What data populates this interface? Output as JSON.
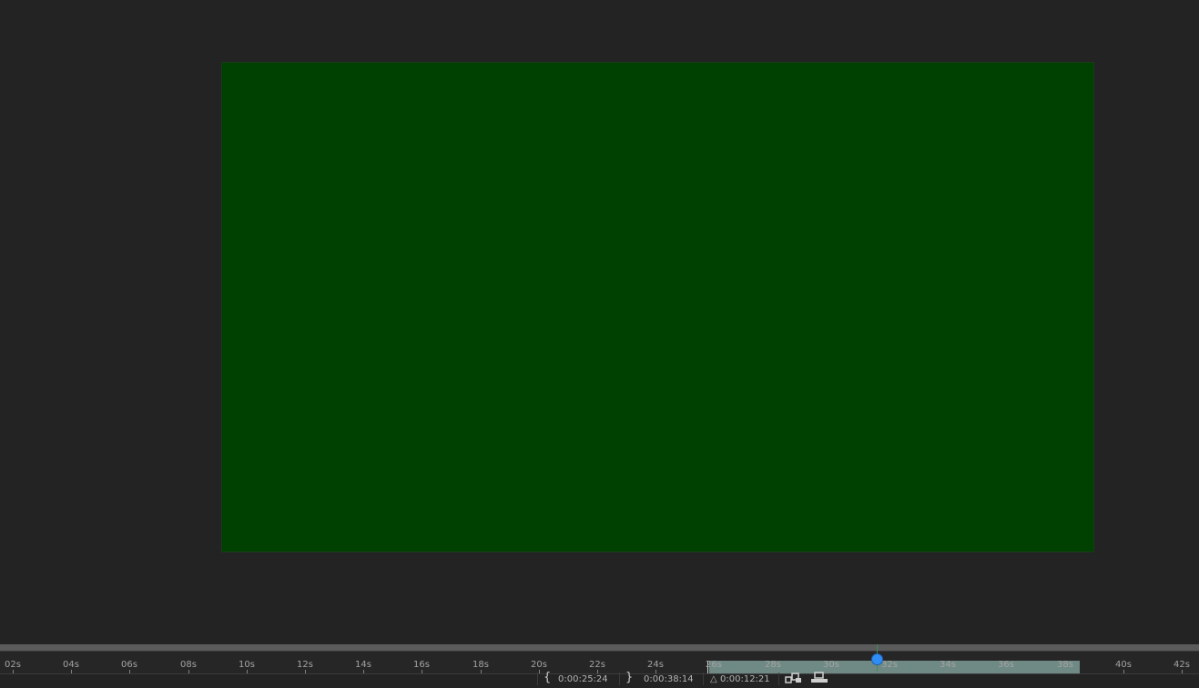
{
  "viewer": {
    "comp_color": "#004000",
    "background_color": "#232323"
  },
  "timeline": {
    "ticks": [
      "02s",
      "04s",
      "06s",
      "08s",
      "10s",
      "12s",
      "14s",
      "16s",
      "18s",
      "20s",
      "22s",
      "24s",
      "26s",
      "28s",
      "30s",
      "32s",
      "34s",
      "36s",
      "38s",
      "40s",
      "42s"
    ],
    "tick_seconds": [
      2,
      4,
      6,
      8,
      10,
      12,
      14,
      16,
      18,
      20,
      22,
      24,
      26,
      28,
      30,
      32,
      34,
      36,
      38,
      40,
      42
    ],
    "work_area_color": "#6f8a84",
    "playhead_color": "#2f8df5"
  },
  "status": {
    "in_icon": "left-brace-icon",
    "in_time": "0:00:25:24",
    "out_icon": "right-brace-icon",
    "out_time": "0:00:38:14",
    "duration_prefix": "△",
    "duration": "0:00:12:21",
    "buttons": [
      "fast-preview-icon",
      "output-module-icon"
    ]
  }
}
